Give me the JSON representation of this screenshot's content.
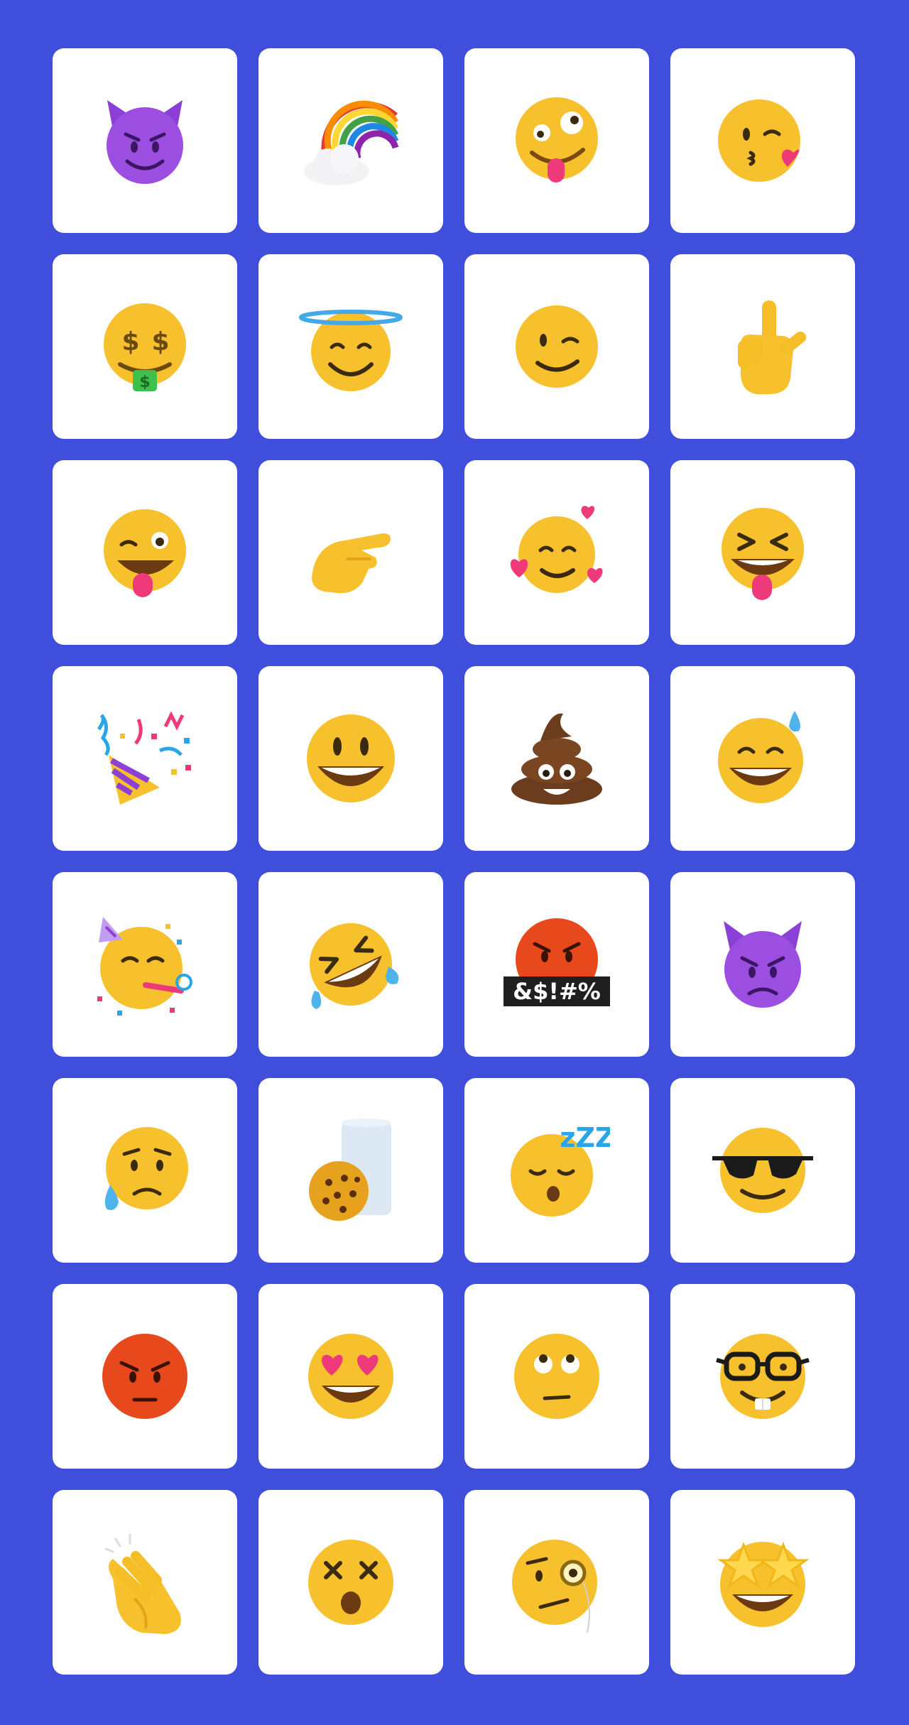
{
  "palette": {
    "background": "#3f4fdc",
    "tile": "#ffffff",
    "face_yellow": "#f7c12d",
    "face_shade": "#e3a317",
    "devil_purple": "#9b4ee0",
    "angry_red": "#e8491c",
    "pink": "#ef3a7a",
    "brown": "#6b3d1e"
  },
  "emoji_tiles": [
    {
      "icon": "smiling-devil-icon"
    },
    {
      "icon": "rainbow-cloud-icon"
    },
    {
      "icon": "zany-face-icon"
    },
    {
      "icon": "kissing-heart-face-icon"
    },
    {
      "icon": "money-mouth-face-icon"
    },
    {
      "icon": "halo-angel-face-icon"
    },
    {
      "icon": "winking-face-icon"
    },
    {
      "icon": "pointing-up-hand-icon"
    },
    {
      "icon": "winking-tongue-face-icon"
    },
    {
      "icon": "pointing-hand-icon"
    },
    {
      "icon": "smiling-face-hearts-icon"
    },
    {
      "icon": "squinting-tongue-face-icon"
    },
    {
      "icon": "party-popper-icon"
    },
    {
      "icon": "grinning-face-icon"
    },
    {
      "icon": "pile-of-poo-icon"
    },
    {
      "icon": "grinning-sweat-face-icon"
    },
    {
      "icon": "partying-face-icon"
    },
    {
      "icon": "rolling-laughing-face-icon"
    },
    {
      "icon": "cursing-face-icon",
      "text": "&$!#%"
    },
    {
      "icon": "angry-devil-icon"
    },
    {
      "icon": "sad-tear-face-icon"
    },
    {
      "icon": "milk-and-cookie-icon"
    },
    {
      "icon": "sleeping-face-icon",
      "text": "zZZ"
    },
    {
      "icon": "sunglasses-face-icon"
    },
    {
      "icon": "angry-red-face-icon"
    },
    {
      "icon": "heart-eyes-face-icon"
    },
    {
      "icon": "rolling-eyes-face-icon"
    },
    {
      "icon": "nerd-face-icon"
    },
    {
      "icon": "clapping-hands-icon"
    },
    {
      "icon": "dizzy-face-icon"
    },
    {
      "icon": "monocle-face-icon"
    },
    {
      "icon": "star-struck-face-icon"
    }
  ]
}
